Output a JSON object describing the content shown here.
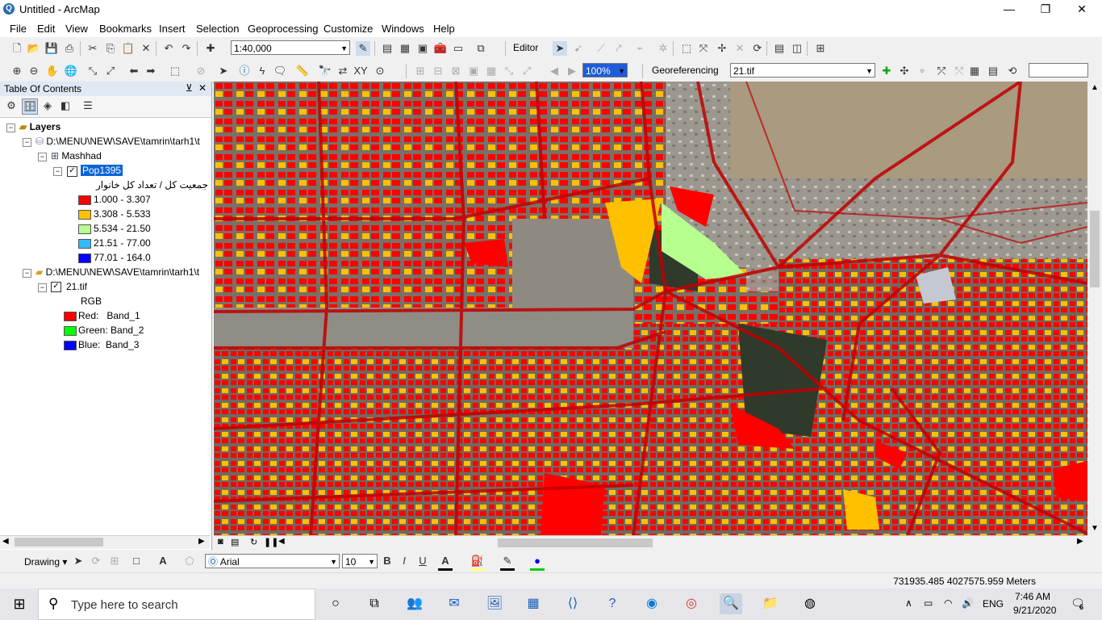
{
  "window": {
    "title": "Untitled - ArcMap",
    "minimize": "—",
    "restore": "❐",
    "close": "✕"
  },
  "menu": [
    "File",
    "Edit",
    "View",
    "Bookmarks",
    "Insert",
    "Selection",
    "Geoprocessing",
    "Customize",
    "Windows",
    "Help"
  ],
  "toolbar": {
    "scale": "1:40,000",
    "editor_label": "Editor",
    "georef_label": "Georeferencing",
    "georef_layer": "21.tif",
    "transparency": "100%"
  },
  "toc": {
    "header": "Table Of Contents",
    "pin": "⊻",
    "close": "✕",
    "root": "Layers",
    "group1_path": "D:\\MENU\\NEW\\SAVE\\tamrin\\tarh1\\t",
    "dataset": "Mashhad",
    "layer": "Pop1395",
    "field_label": "جمعیت کل / تعداد کل خانوار",
    "classes": [
      {
        "label": "1.000 - 3.307",
        "color": "#ff0000"
      },
      {
        "label": "3.308 - 5.533",
        "color": "#ffc000"
      },
      {
        "label": "5.534 - 21.50",
        "color": "#b7ff8f"
      },
      {
        "label": "21.51 - 77.00",
        "color": "#33bbff"
      },
      {
        "label": "77.01 - 164.0",
        "color": "#0000ff"
      }
    ],
    "group2_path": "D:\\MENU\\NEW\\SAVE\\tamrin\\tarh1\\t",
    "raster": "21.tif",
    "rgb_label": "RGB",
    "bands": [
      {
        "label": "Red:   Band_1",
        "color": "#ff0000"
      },
      {
        "label": "Green: Band_2",
        "color": "#00ff00"
      },
      {
        "label": "Blue:  Band_3",
        "color": "#0000ff"
      }
    ]
  },
  "drawing": {
    "label": "Drawing",
    "font": "Arial",
    "size": "10",
    "bold": "B",
    "italic": "I",
    "underline": "U"
  },
  "status": {
    "coords": "731935.485  4027575.959 Meters"
  },
  "taskbar": {
    "search_placeholder": "Type here to search",
    "lang": "ENG",
    "time": "7:46 AM",
    "date": "9/21/2020",
    "notif_count": "6"
  }
}
